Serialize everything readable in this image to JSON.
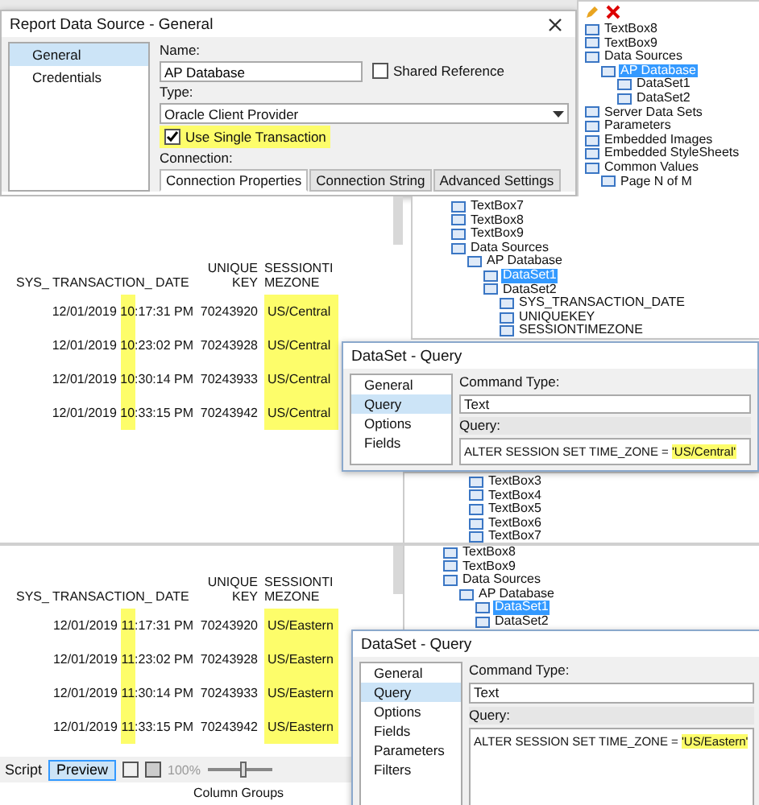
{
  "datasource_dialog": {
    "title": "Report Data Source - General",
    "nav": [
      {
        "label": "General",
        "selected": true
      },
      {
        "label": "Credentials",
        "selected": false
      }
    ],
    "name_label": "Name:",
    "name_value": "AP Database",
    "shared_reference": {
      "label": "Shared Reference",
      "checked": false
    },
    "type_label": "Type:",
    "type_value": "Oracle Client Provider",
    "single_transaction": {
      "label": "Use Single Transaction",
      "checked": true
    },
    "connection_label": "Connection:",
    "tabs": [
      {
        "label": "Connection Properties",
        "selected": true
      },
      {
        "label": "Connection String",
        "selected": false
      },
      {
        "label": "Advanced Settings",
        "selected": false
      }
    ]
  },
  "top_tree": {
    "items": [
      {
        "label": "TextBox8",
        "selected": false
      },
      {
        "label": "TextBox9",
        "selected": false
      },
      {
        "label": "Data Sources",
        "selected": false,
        "children": [
          {
            "label": "AP Database",
            "selected": true,
            "children": [
              {
                "label": "DataSet1",
                "selected": false
              },
              {
                "label": "DataSet2",
                "selected": false
              }
            ]
          }
        ]
      },
      {
        "label": "Server Data Sets",
        "selected": false
      },
      {
        "label": "Parameters",
        "selected": false
      },
      {
        "label": "Embedded Images",
        "selected": false
      },
      {
        "label": "Embedded StyleSheets",
        "selected": false
      },
      {
        "label": "Common Values",
        "selected": false,
        "children": [
          {
            "label": "Page N of M",
            "selected": false
          }
        ]
      }
    ]
  },
  "central": {
    "report": {
      "columns": [
        "SYS_ TRANSACTION_ DATE",
        "UNIQUEKEY",
        "SESSIONTIMEZONE"
      ],
      "rows": [
        {
          "date": "12/01/2019",
          "hour": "10",
          "time_rest": ":17:31 PM",
          "key": "70243920",
          "zone": "US/Central"
        },
        {
          "date": "12/01/2019",
          "hour": "10",
          "time_rest": ":23:02 PM",
          "key": "70243928",
          "zone": "US/Central"
        },
        {
          "date": "12/01/2019",
          "hour": "10",
          "time_rest": ":30:14 PM",
          "key": "70243933",
          "zone": "US/Central"
        },
        {
          "date": "12/01/2019",
          "hour": "10",
          "time_rest": ":33:15 PM",
          "key": "70243942",
          "zone": "US/Central"
        }
      ]
    },
    "tree": {
      "items": [
        {
          "label": "TextBox7",
          "selected": false
        },
        {
          "label": "TextBox8",
          "selected": false
        },
        {
          "label": "TextBox9",
          "selected": false
        },
        {
          "label": "Data Sources",
          "selected": false,
          "children": [
            {
              "label": "AP Database",
              "selected": false,
              "children": [
                {
                  "label": "DataSet1",
                  "selected": true
                },
                {
                  "label": "DataSet2",
                  "selected": false,
                  "children": [
                    {
                      "label": "SYS_TRANSACTION_DATE",
                      "selected": false
                    },
                    {
                      "label": "UNIQUEKEY",
                      "selected": false
                    },
                    {
                      "label": "SESSIONTIMEZONE",
                      "selected": false
                    }
                  ]
                }
              ]
            }
          ]
        }
      ]
    },
    "query_dialog": {
      "title": "DataSet - Query",
      "nav": [
        {
          "label": "General",
          "selected": false
        },
        {
          "label": "Query",
          "selected": true
        },
        {
          "label": "Options",
          "selected": false
        },
        {
          "label": "Fields",
          "selected": false
        }
      ],
      "command_type_label": "Command Type:",
      "command_type": "Text",
      "query_label": "Query:",
      "query_prefix": "ALTER SESSION SET TIME_ZONE = ",
      "query_value": "'US/Central'"
    },
    "lower_tree": {
      "items": [
        {
          "label": "TextBox3",
          "selected": false
        },
        {
          "label": "TextBox4",
          "selected": false
        },
        {
          "label": "TextBox5",
          "selected": false
        },
        {
          "label": "TextBox6",
          "selected": false
        },
        {
          "label": "TextBox7",
          "selected": false
        }
      ]
    }
  },
  "eastern": {
    "report": {
      "columns": [
        "SYS_ TRANSACTION_ DATE",
        "UNIQUEKEY",
        "SESSIONTIMEZONE"
      ],
      "rows": [
        {
          "date": "12/01/2019",
          "hour": "11",
          "time_rest": ":17:31 PM",
          "key": "70243920",
          "zone": "US/Eastern"
        },
        {
          "date": "12/01/2019",
          "hour": "11",
          "time_rest": ":23:02 PM",
          "key": "70243928",
          "zone": "US/Eastern"
        },
        {
          "date": "12/01/2019",
          "hour": "11",
          "time_rest": ":30:14 PM",
          "key": "70243933",
          "zone": "US/Eastern"
        },
        {
          "date": "12/01/2019",
          "hour": "11",
          "time_rest": ":33:15 PM",
          "key": "70243942",
          "zone": "US/Eastern"
        }
      ]
    },
    "tree": {
      "items": [
        {
          "label": "TextBox8",
          "selected": false
        },
        {
          "label": "TextBox9",
          "selected": false
        },
        {
          "label": "Data Sources",
          "selected": false,
          "children": [
            {
              "label": "AP Database",
              "selected": false,
              "children": [
                {
                  "label": "DataSet1",
                  "selected": true
                },
                {
                  "label": "DataSet2",
                  "selected": false
                }
              ]
            }
          ]
        }
      ]
    },
    "query_dialog": {
      "title": "DataSet - Query",
      "nav": [
        {
          "label": "General",
          "selected": false
        },
        {
          "label": "Query",
          "selected": true
        },
        {
          "label": "Options",
          "selected": false
        },
        {
          "label": "Fields",
          "selected": false
        },
        {
          "label": "Parameters",
          "selected": false
        },
        {
          "label": "Filters",
          "selected": false
        }
      ],
      "command_type_label": "Command Type:",
      "command_type": "Text",
      "query_label": "Query:",
      "query_prefix": "ALTER SESSION SET TIME_ZONE = ",
      "query_value": "'US/Eastern'"
    },
    "toolbar": {
      "script": "Script",
      "preview": "Preview",
      "preview_selected": true,
      "zoom": "100%",
      "zoom_slider": {
        "level": 0.55
      },
      "column_groups": "Column Groups"
    }
  }
}
